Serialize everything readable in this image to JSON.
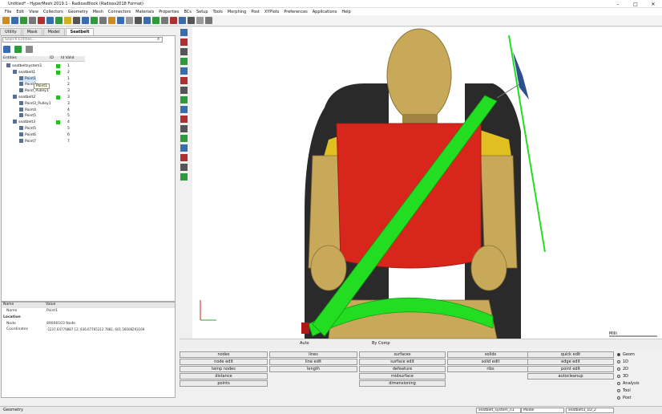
{
  "window": {
    "title": "Untitled* - HyperMesh 2019.1 - RadiossBlock (Radioss2018 Format)"
  },
  "menu": [
    "File",
    "Edit",
    "View",
    "Collectors",
    "Geometry",
    "Mesh",
    "Connectors",
    "Materials",
    "Properties",
    "BCs",
    "Setup",
    "Tools",
    "Morphing",
    "Post",
    "XYPlots",
    "Preferences",
    "Applications",
    "Help"
  ],
  "browser_tabs": [
    "Utility",
    "Mask",
    "Model",
    "Seatbelt"
  ],
  "search": {
    "placeholder": "Search Entities..."
  },
  "tree": {
    "headers": [
      "Entities",
      "ID",
      "Id Valid"
    ],
    "rows": [
      {
        "label": "seatbeltsystem1",
        "id": "1",
        "indent": 0
      },
      {
        "label": "seatbelt1",
        "id": "2",
        "indent": 1
      },
      {
        "label": "Point1",
        "id": "1",
        "indent": 2,
        "selected": true
      },
      {
        "label": "Point2",
        "id": "2",
        "indent": 2
      },
      {
        "label": "Point_Pulley1",
        "id": "3",
        "indent": 2
      },
      {
        "label": "seatbelt2",
        "id": "3",
        "indent": 1
      },
      {
        "label": "Point3_Pulley1",
        "id": "3",
        "indent": 2
      },
      {
        "label": "Point4",
        "id": "4",
        "indent": 2
      },
      {
        "label": "Point5",
        "id": "5",
        "indent": 2
      },
      {
        "label": "seatbelt3",
        "id": "4",
        "indent": 1
      },
      {
        "label": "Point5",
        "id": "5",
        "indent": 2
      },
      {
        "label": "Point6",
        "id": "6",
        "indent": 2
      },
      {
        "label": "Point7",
        "id": "7",
        "indent": 2
      }
    ],
    "tooltip": "Point1"
  },
  "properties": {
    "headers": [
      "Name",
      "Value"
    ],
    "name_label": "Name",
    "name_value": "Point1",
    "section": "Location",
    "node_label": "Node",
    "node_value": "89006103 Node",
    "coord_label": "Coordinates",
    "coord_value": "-2237.64779887 12, 836.67765312 7881, 601.56008293169"
  },
  "viewport": {
    "ruler_label": "Milli"
  },
  "bottom_toolbar": {
    "auto": "Auto",
    "bycomp": "By Comp"
  },
  "macros": {
    "col1": [
      "nodes",
      "node edit",
      "temp nodes",
      "distance",
      "points"
    ],
    "col2": [
      "lines",
      "line edit",
      "length"
    ],
    "col3": [
      "surfaces",
      "surface edit",
      "defeature",
      "midsurface",
      "dimensioning"
    ],
    "col4": [
      "solids",
      "solid edit",
      "ribs"
    ],
    "col5": [
      "quick edit",
      "edge edit",
      "point edit",
      "autocleanup"
    ]
  },
  "page_types": [
    {
      "label": "Geom",
      "selected": true
    },
    {
      "label": "1D"
    },
    {
      "label": "2D"
    },
    {
      "label": "3D"
    },
    {
      "label": "Analysis"
    },
    {
      "label": "Tool"
    },
    {
      "label": "Post"
    }
  ],
  "status": {
    "left": "Geometry",
    "box1": "seatbelt_system_n1",
    "box2": "Model",
    "box3": "seatbelt3_1D_2"
  },
  "colors": {
    "torso": "#d9261c",
    "dummy": "#c8a95a",
    "belt": "#22dd22",
    "seat": "#2a2a2a"
  }
}
